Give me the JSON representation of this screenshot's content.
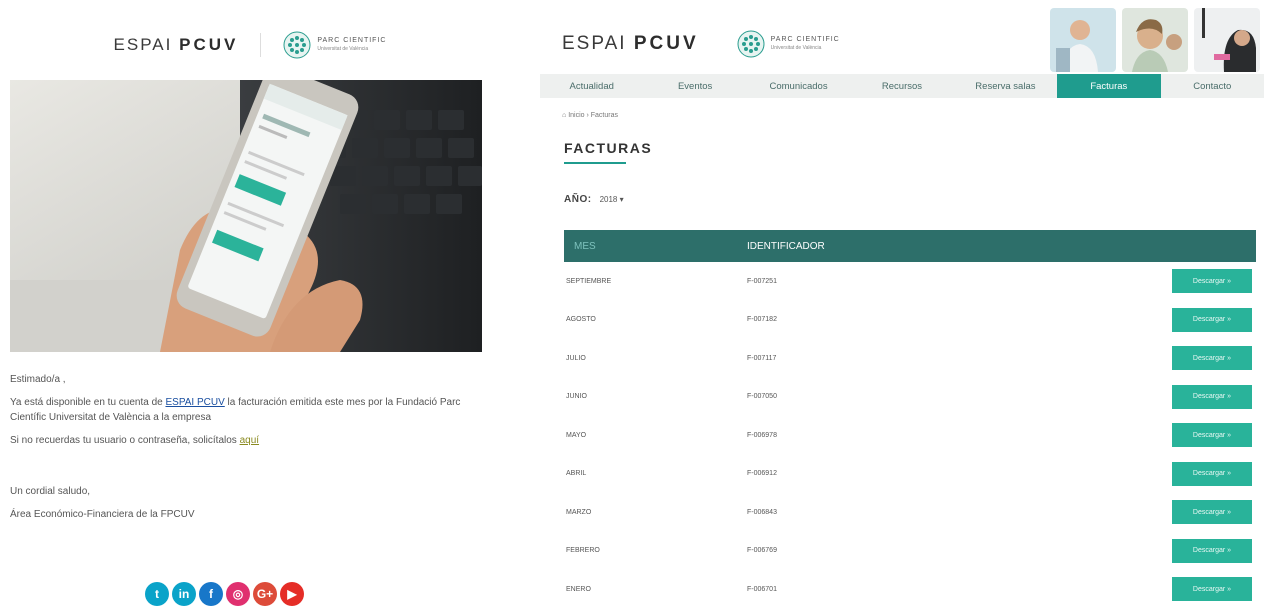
{
  "email": {
    "brand_light": "ESPAI",
    "brand_bold": "PCUV",
    "parc_line1": "PARC CIENTIFIC",
    "parc_line2": "Universitat de València",
    "greeting": "Estimado/a ,",
    "body_part1": "Ya está disponible en tu cuenta de ",
    "body_link": "ESPAI PCUV",
    "body_part2": " la facturación emitida este mes por la Fundació Parc Científic Universitat de València a la empresa",
    "forgot_text": "Si no recuerdas tu usuario o contraseña, solicítalos ",
    "forgot_link": "aquí",
    "closing": "Un cordial saludo,",
    "signature": "Área Económico-Financiera de la FPCUV",
    "social_icons": [
      "twitter-icon",
      "linkedin-icon",
      "facebook-icon",
      "instagram-icon",
      "google-plus-icon",
      "youtube-icon"
    ]
  },
  "site": {
    "brand_light": "ESPAI",
    "brand_bold": "PCUV",
    "parc_line1": "PARC CIENTIFIC",
    "parc_line2": "Universitat de València",
    "nav": [
      "Actualidad",
      "Eventos",
      "Comunicados",
      "Recursos",
      "Reserva salas",
      "Facturas",
      "Contacto"
    ],
    "nav_active": "Facturas",
    "breadcrumb": "Inicio › Facturas",
    "page_title": "FACTURAS",
    "year_label": "AÑO:",
    "year_value": "2018 ▾",
    "table": {
      "col_month": "MES",
      "col_id": "IDENTIFICADOR",
      "download_label": "Descargar »",
      "rows": [
        {
          "month": "SEPTIEMBRE",
          "id": "F-007251"
        },
        {
          "month": "AGOSTO",
          "id": "F-007182"
        },
        {
          "month": "JULIO",
          "id": "F-007117"
        },
        {
          "month": "JUNIO",
          "id": "F-007050"
        },
        {
          "month": "MAYO",
          "id": "F-006978"
        },
        {
          "month": "ABRIL",
          "id": "F-006912"
        },
        {
          "month": "MARZO",
          "id": "F-006843"
        },
        {
          "month": "FEBRERO",
          "id": "F-006769"
        },
        {
          "month": "ENERO",
          "id": "F-006701"
        }
      ]
    }
  },
  "colors": {
    "accent": "#1f9c8e",
    "table_header": "#2d6f6a",
    "download_button": "#29b39a"
  }
}
